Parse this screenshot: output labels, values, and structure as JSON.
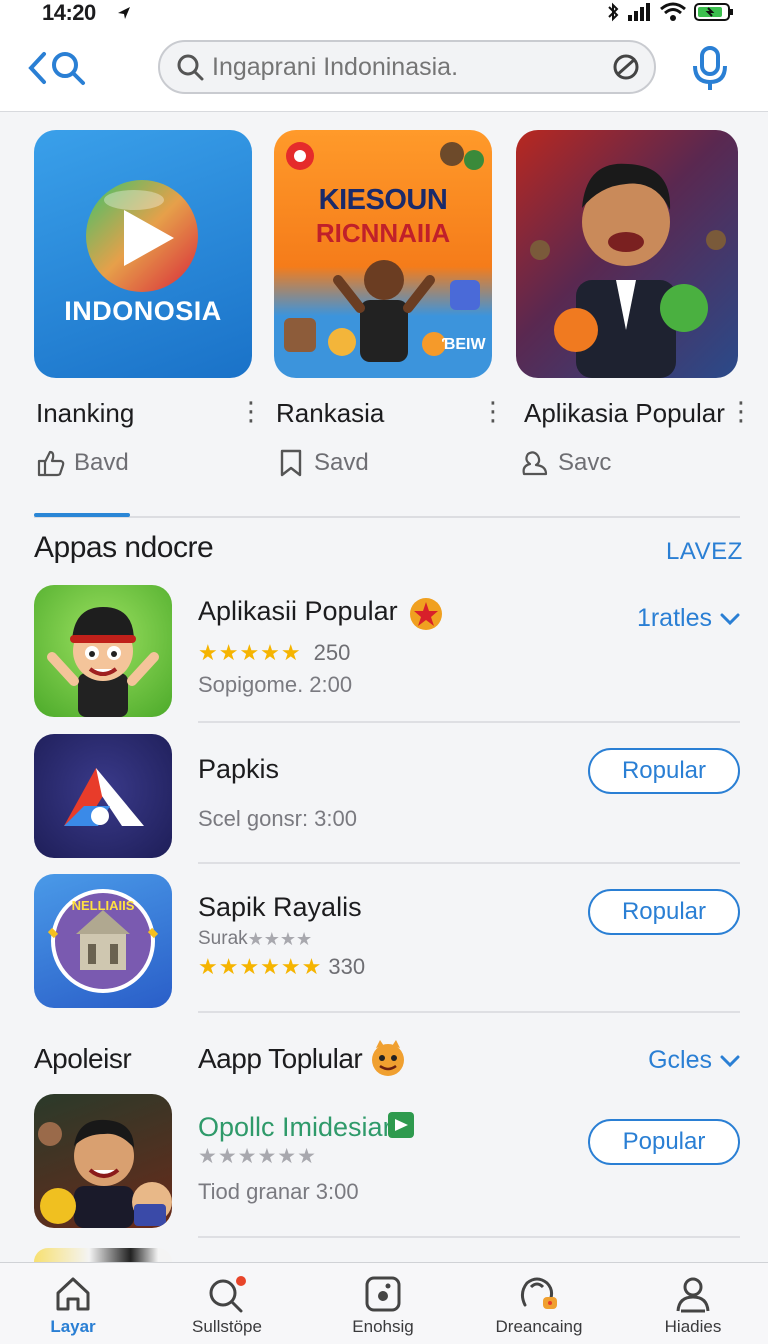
{
  "status_bar": {
    "time": "14:20"
  },
  "search": {
    "placeholder": "Ingaprani Indoninasia."
  },
  "featured": [
    {
      "name": "Inanking",
      "action": "Bavd",
      "tile_text": "INDONOSIA"
    },
    {
      "name": "Rankasia",
      "action": "Savd",
      "tile_title": "KIESOUN",
      "tile_subtitle": "RICNNAIIA",
      "tile_badge": "ƁEIW"
    },
    {
      "name": "Aplikasia Popular",
      "action": "Savc"
    }
  ],
  "section1": {
    "title": "Appas ndocre",
    "link": "LAVEZ",
    "rows": [
      {
        "title": "Aplikasii Popular",
        "rating_count": "250",
        "meta": "Sopigome. 2:00",
        "link": "1ratles",
        "stars": 5
      },
      {
        "title": "Papkis",
        "meta": "Scel gonsr: 3:00",
        "button": "Ropular"
      },
      {
        "title": "Sapik Rayalis",
        "meta": "Surak",
        "rating_count": "330",
        "button": "Ropular",
        "stars": 6,
        "tile_text": "NELLIAIIS"
      }
    ]
  },
  "section2": {
    "title_left": "Apoleisr",
    "title_mid": "Aapp Toplular",
    "link": "Gcles",
    "rows": [
      {
        "title": "Opollc Imidesiar",
        "meta": "Tiod granar 3:00",
        "button": "Popular",
        "stars": 6
      }
    ]
  },
  "bottom_nav": [
    {
      "label": "Layar",
      "icon": "home-icon",
      "active": true
    },
    {
      "label": "Sullstöpe",
      "icon": "search-icon",
      "active": false
    },
    {
      "label": "Enohsig",
      "icon": "apps-icon",
      "active": false
    },
    {
      "label": "Dreancaing",
      "icon": "arcade-icon",
      "active": false
    },
    {
      "label": "Hiadies",
      "icon": "profile-icon",
      "active": false
    }
  ],
  "colors": {
    "accent": "#2a7fd4",
    "star": "#f5b400",
    "green_text": "#2f9a6a"
  }
}
